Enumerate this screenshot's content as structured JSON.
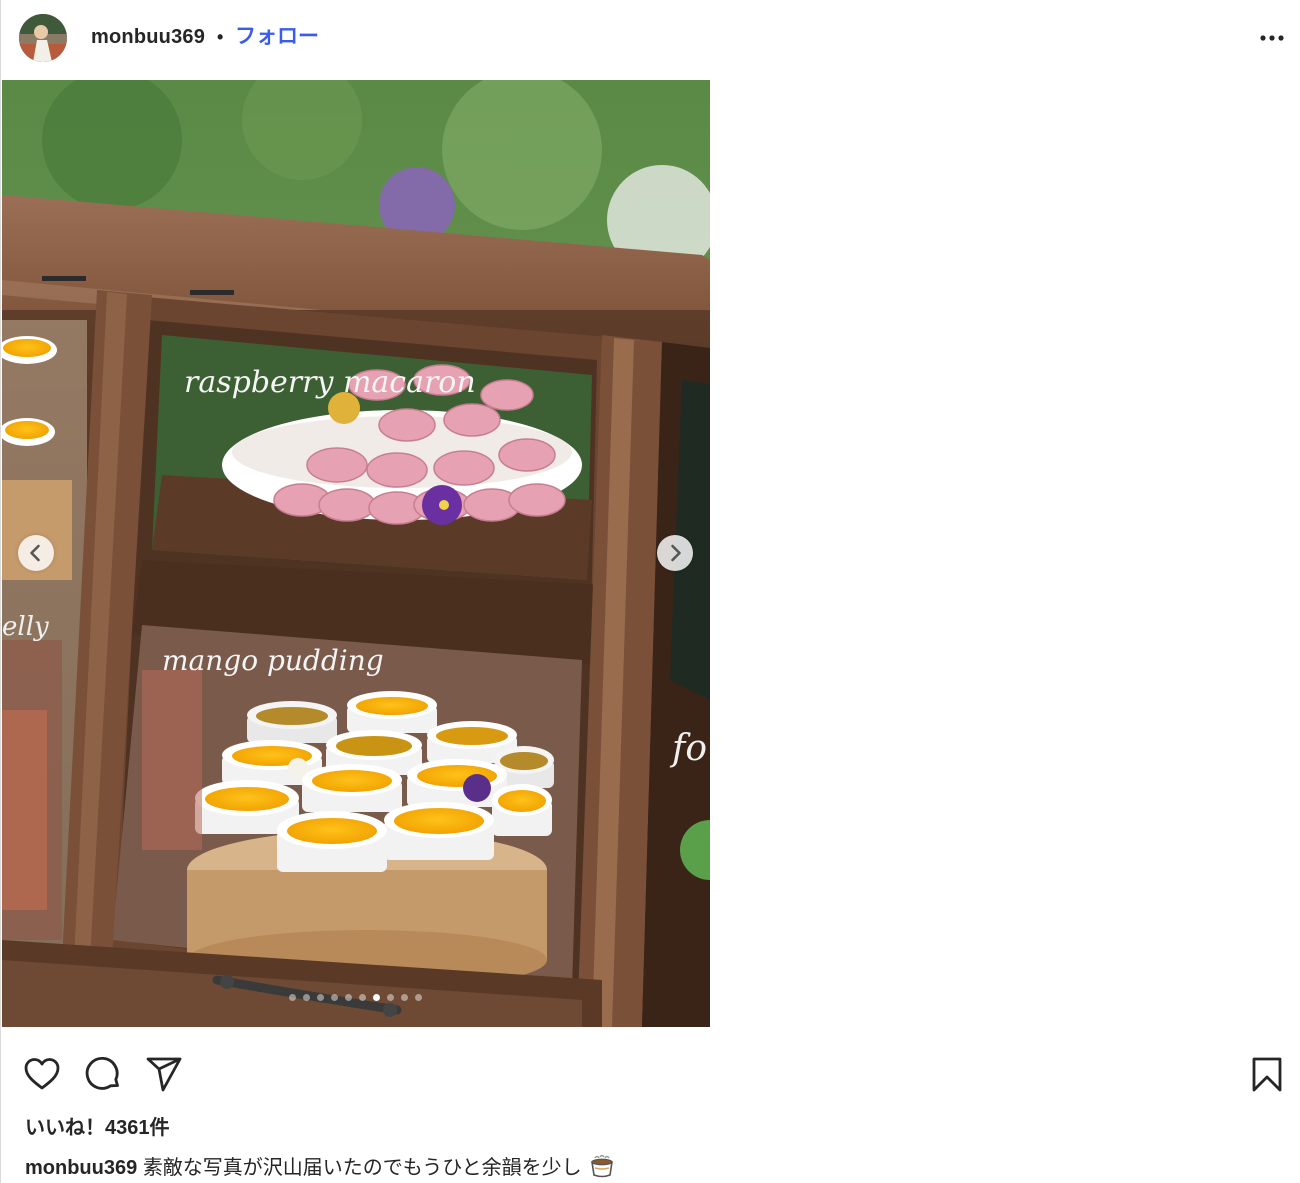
{
  "post": {
    "username": "monbuu369",
    "separator": "•",
    "follow_label": "フォロー",
    "more_icon": "more-horizontal-icon"
  },
  "media": {
    "carousel_total": 10,
    "carousel_active_index": 6,
    "prev_icon": "chevron-left-icon",
    "next_icon": "chevron-right-icon"
  },
  "actions": {
    "like_icon": "heart-icon",
    "comment_icon": "comment-icon",
    "share_icon": "send-icon",
    "save_icon": "bookmark-icon"
  },
  "likes_text": "いいね！4361件",
  "caption": {
    "username": "monbuu369",
    "text": "素敵な写真が沢山届いたのでもうひと余韻を少し",
    "emoji_icon": "coffee-cup-icon"
  },
  "colors": {
    "follow_blue": "#3a5bf0",
    "text": "#262626"
  }
}
